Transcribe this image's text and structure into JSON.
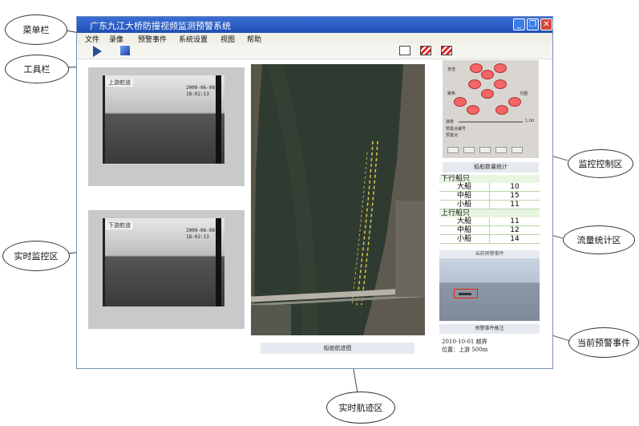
{
  "callouts": {
    "menubar": "菜单栏",
    "toolbar": "工具栏",
    "realtime_monitor": "实时监控区",
    "monitor_control": "监控控制区",
    "flow_stats": "流量统计区",
    "current_alarm": "当前预警事件",
    "realtime_track": "实时航迹区"
  },
  "window": {
    "title": "广东九江大桥防撞视频监测预警系统"
  },
  "menu": [
    "文件",
    "录像",
    "预警事件",
    "系统设置",
    "视图",
    "帮助"
  ],
  "cameras": {
    "upstream": {
      "label": "上游航道",
      "osd_date": "2009-06-08",
      "osd_time": "18:02:13"
    },
    "downstream": {
      "label": "下游航道",
      "osd_date": "2009-06-08",
      "osd_time": "18:02:13"
    }
  },
  "map": {
    "caption": "船舶航迹图"
  },
  "control": {
    "labels": {
      "zoom_in": "变倍",
      "focus_near": "聚焦",
      "focus_far": "光圈",
      "speed": "速度",
      "speed_value": "1.00",
      "preset": "预置点编号",
      "preset2": "预置点"
    }
  },
  "stats": {
    "title": "船舶数量统计",
    "groups": [
      {
        "name": "下行船只",
        "rows": [
          {
            "k": "大船",
            "v": "10"
          },
          {
            "k": "中船",
            "v": "15"
          },
          {
            "k": "小船",
            "v": "11"
          }
        ]
      },
      {
        "name": "上行船只",
        "rows": [
          {
            "k": "大船",
            "v": "11"
          },
          {
            "k": "中船",
            "v": "12"
          },
          {
            "k": "小船",
            "v": "14"
          }
        ]
      }
    ]
  },
  "alarm": {
    "title": "当前预警事件",
    "note_title": "预警事件备注",
    "line1": "2010-10-01 越界",
    "line2": "位置：上游 500m"
  }
}
